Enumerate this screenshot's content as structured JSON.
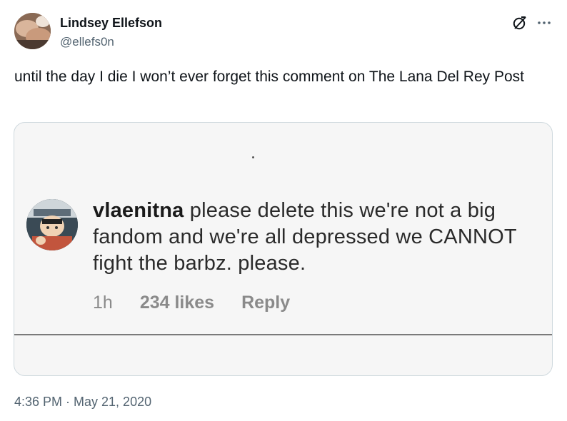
{
  "author": {
    "name": "Lindsey Ellefson",
    "handle": "@ellefs0n"
  },
  "header_icons": [
    "grok-icon",
    "more-options-icon"
  ],
  "tweet": {
    "text": "until the day I die I won’t ever forget this comment on The Lana Del Rey Post",
    "timestamp": "4:36 PM · May 21, 2020"
  },
  "embedded_comment": {
    "username": "vlaenitna",
    "text": " please delete this we're not a big fandom and we're all depressed we CANNOT fight the barbz. please.",
    "time_ago": "1h",
    "likes": "234 likes",
    "reply_label": "Reply"
  },
  "colors": {
    "text_primary": "#0f1419",
    "text_secondary": "#536471",
    "card_border": "#cfd9de",
    "card_background": "#f6f6f6",
    "comment_meta": "#8a8a8a"
  }
}
